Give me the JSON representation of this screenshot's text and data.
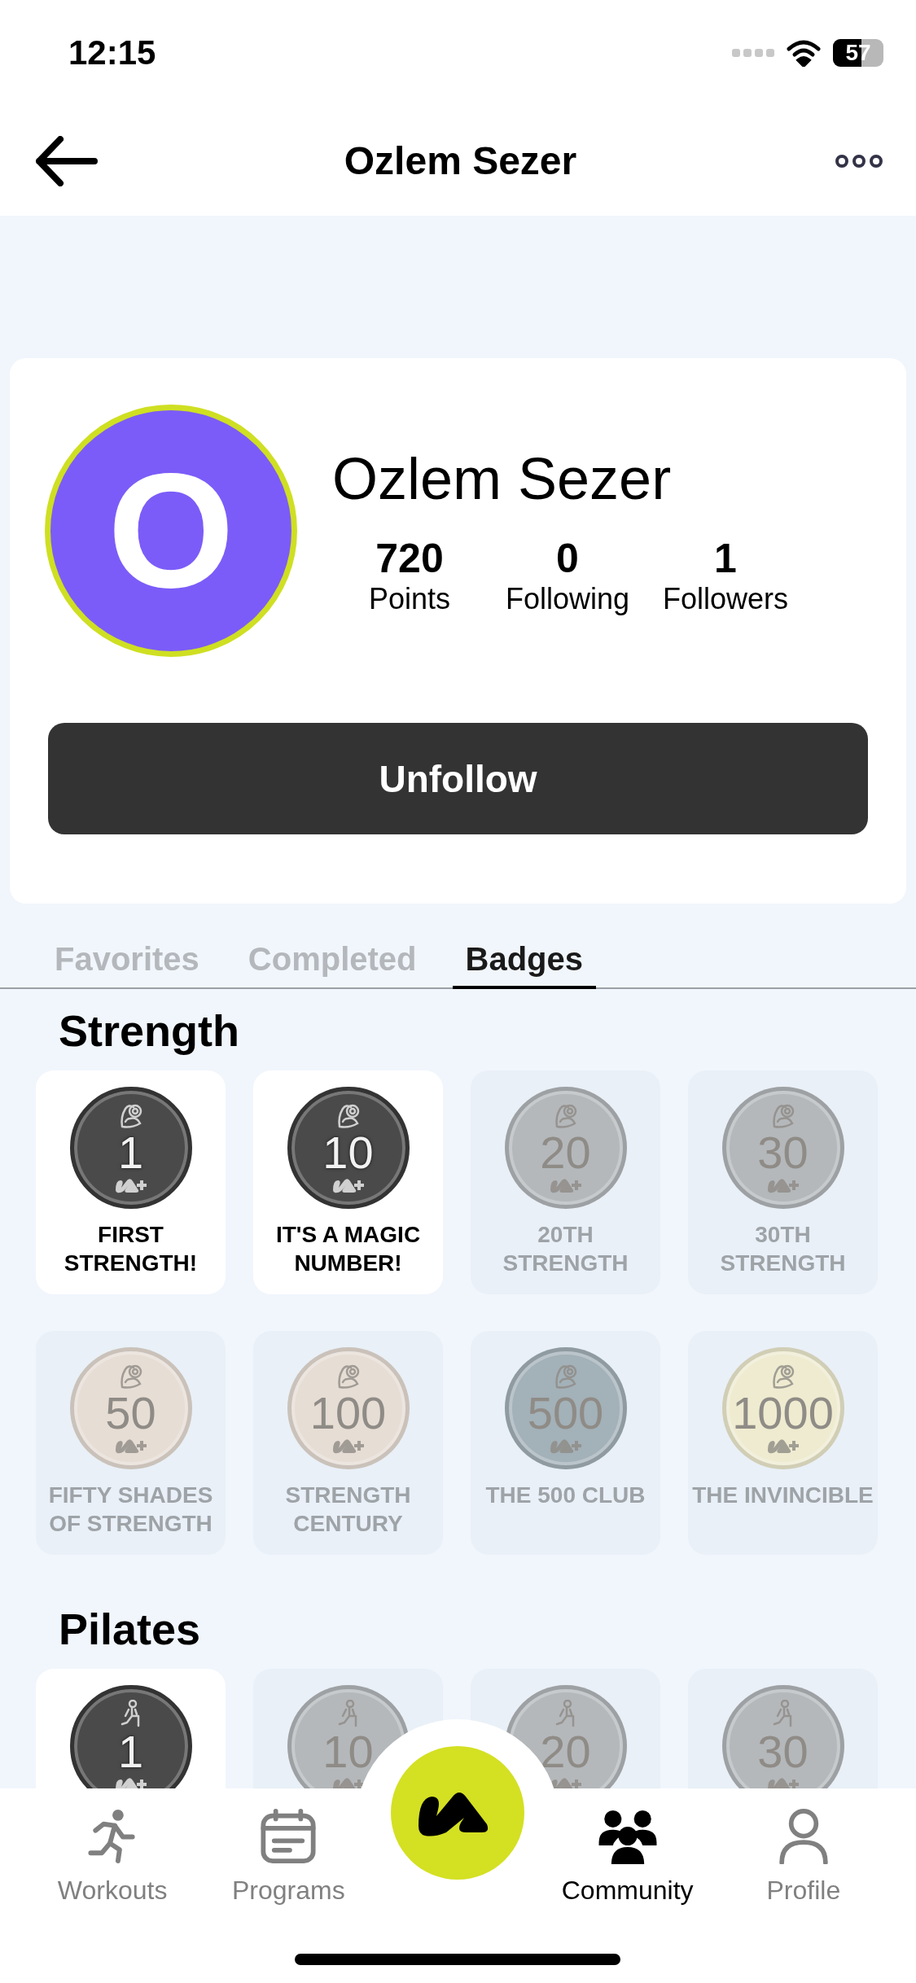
{
  "status_bar": {
    "time": "12:15",
    "battery": "57"
  },
  "header": {
    "title": "Ozlem Sezer"
  },
  "profile": {
    "initial": "O",
    "name": "Ozlem Sezer",
    "stats": [
      {
        "value": "720",
        "label": "Points"
      },
      {
        "value": "0",
        "label": "Following"
      },
      {
        "value": "1",
        "label": "Followers"
      }
    ],
    "button": "Unfollow"
  },
  "tabs": [
    {
      "label": "Favorites",
      "selected": false
    },
    {
      "label": "Completed",
      "selected": false
    },
    {
      "label": "Badges",
      "selected": true
    }
  ],
  "sections": [
    {
      "title": "Strength",
      "badges": [
        {
          "number": "1",
          "label": "FIRST STRENGTH!",
          "earned": true,
          "color": "#4a4a4a"
        },
        {
          "number": "10",
          "label": "IT'S A MAGIC NUMBER!",
          "earned": true,
          "color": "#4a4a4a"
        },
        {
          "number": "20",
          "label": "20TH STRENGTH",
          "earned": false,
          "color": "#b4b8bb"
        },
        {
          "number": "30",
          "label": "30TH STRENGTH",
          "earned": false,
          "color": "#b4b8bb"
        },
        {
          "number": "50",
          "label": "FIFTY SHADES OF STRENGTH",
          "earned": false,
          "color": "#e6ddd4"
        },
        {
          "number": "100",
          "label": "STRENGTH CENTURY",
          "earned": false,
          "color": "#e6ddd4"
        },
        {
          "number": "500",
          "label": "THE 500 CLUB",
          "earned": false,
          "color": "#a3b1b8"
        },
        {
          "number": "1000",
          "label": "THE INVINCIBLE",
          "earned": false,
          "color": "#eeebd0"
        }
      ]
    },
    {
      "title": "Pilates",
      "badges": [
        {
          "number": "1",
          "earned": true,
          "color": "#4a4a4a"
        },
        {
          "number": "10",
          "earned": false,
          "color": "#b4b8bb"
        },
        {
          "number": "20",
          "earned": false,
          "color": "#b4b8bb"
        },
        {
          "number": "30",
          "earned": false,
          "color": "#b4b8bb"
        }
      ]
    }
  ],
  "nav": [
    {
      "label": "Workouts",
      "selected": false
    },
    {
      "label": "Programs",
      "selected": false
    },
    {
      "label": "Community",
      "selected": true
    },
    {
      "label": "Profile",
      "selected": false
    }
  ]
}
